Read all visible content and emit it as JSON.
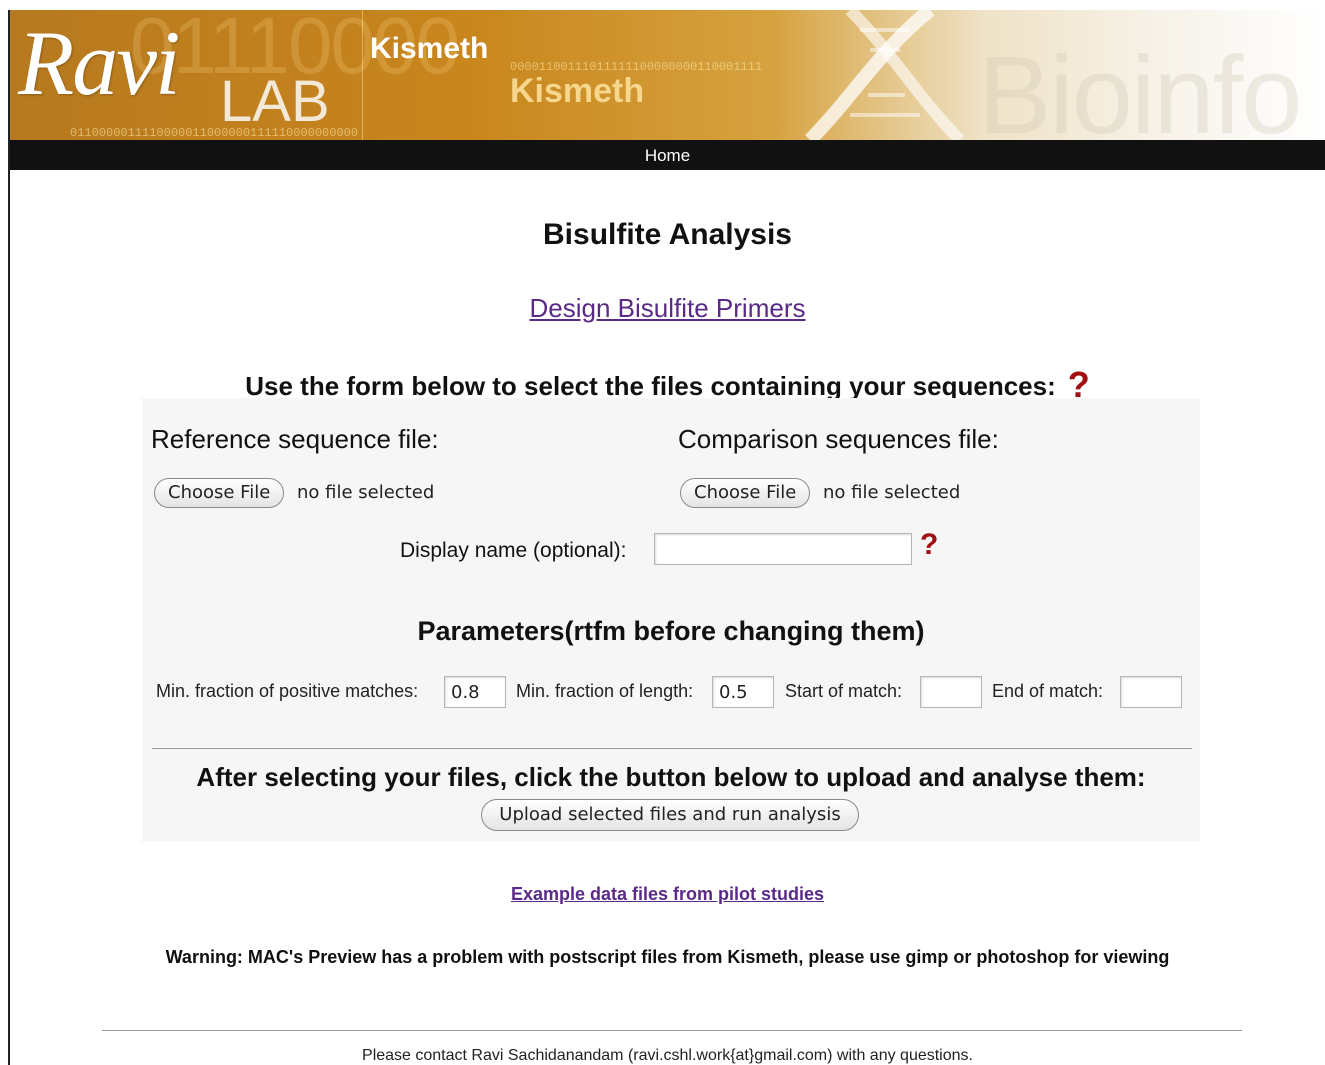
{
  "banner": {
    "brand_script": "Ravi",
    "brand_lab": "LAB",
    "app_name_primary": "Kismeth",
    "app_name_secondary": "Kismeth",
    "binary_top": "00001100111011111100000000110001111",
    "binary_bottom": "0110000011110000011000000111110000000000",
    "big_digits": "01110000",
    "watermark": "Bioinfo"
  },
  "nav": {
    "home": "Home"
  },
  "main": {
    "title": "Bisulfite Analysis",
    "design_link": "Design Bisulfite Primers",
    "instructions": "Use the form below to select the files containing your sequences:",
    "help_symbol": "?"
  },
  "form": {
    "reference_label": "Reference sequence file:",
    "comparison_label": "Comparison sequences file:",
    "choose_file_label": "Choose File",
    "no_file_text": "no file selected",
    "display_name_label": "Display name (optional):",
    "display_name_value": "",
    "parameters_heading": "Parameters(rtfm before changing them)",
    "params": {
      "min_fraction_positive_label": "Min. fraction of positive matches:",
      "min_fraction_positive_value": "0.8",
      "min_fraction_length_label": "Min. fraction of length:",
      "min_fraction_length_value": "0.5",
      "start_match_label": "Start of match:",
      "start_match_value": "",
      "end_match_label": "End of match:",
      "end_match_value": ""
    },
    "after_text": "After selecting your files, click the button below to upload and analyse them:",
    "upload_button": "Upload selected files and run analysis"
  },
  "footer": {
    "example_link": "Example data files from pilot studies",
    "warning": "Warning: MAC's Preview has a problem with postscript files from Kismeth, please use gimp or photoshop for viewing",
    "contact": "Please contact Ravi Sachidanandam (ravi.cshl.work{at}gmail.com) with any questions."
  },
  "colors": {
    "banner_gold": "#c9861d",
    "nav_bg": "#111111",
    "link_purple": "#5a2a86",
    "help_red": "#a01010",
    "panel_bg": "#f6f6f6"
  }
}
